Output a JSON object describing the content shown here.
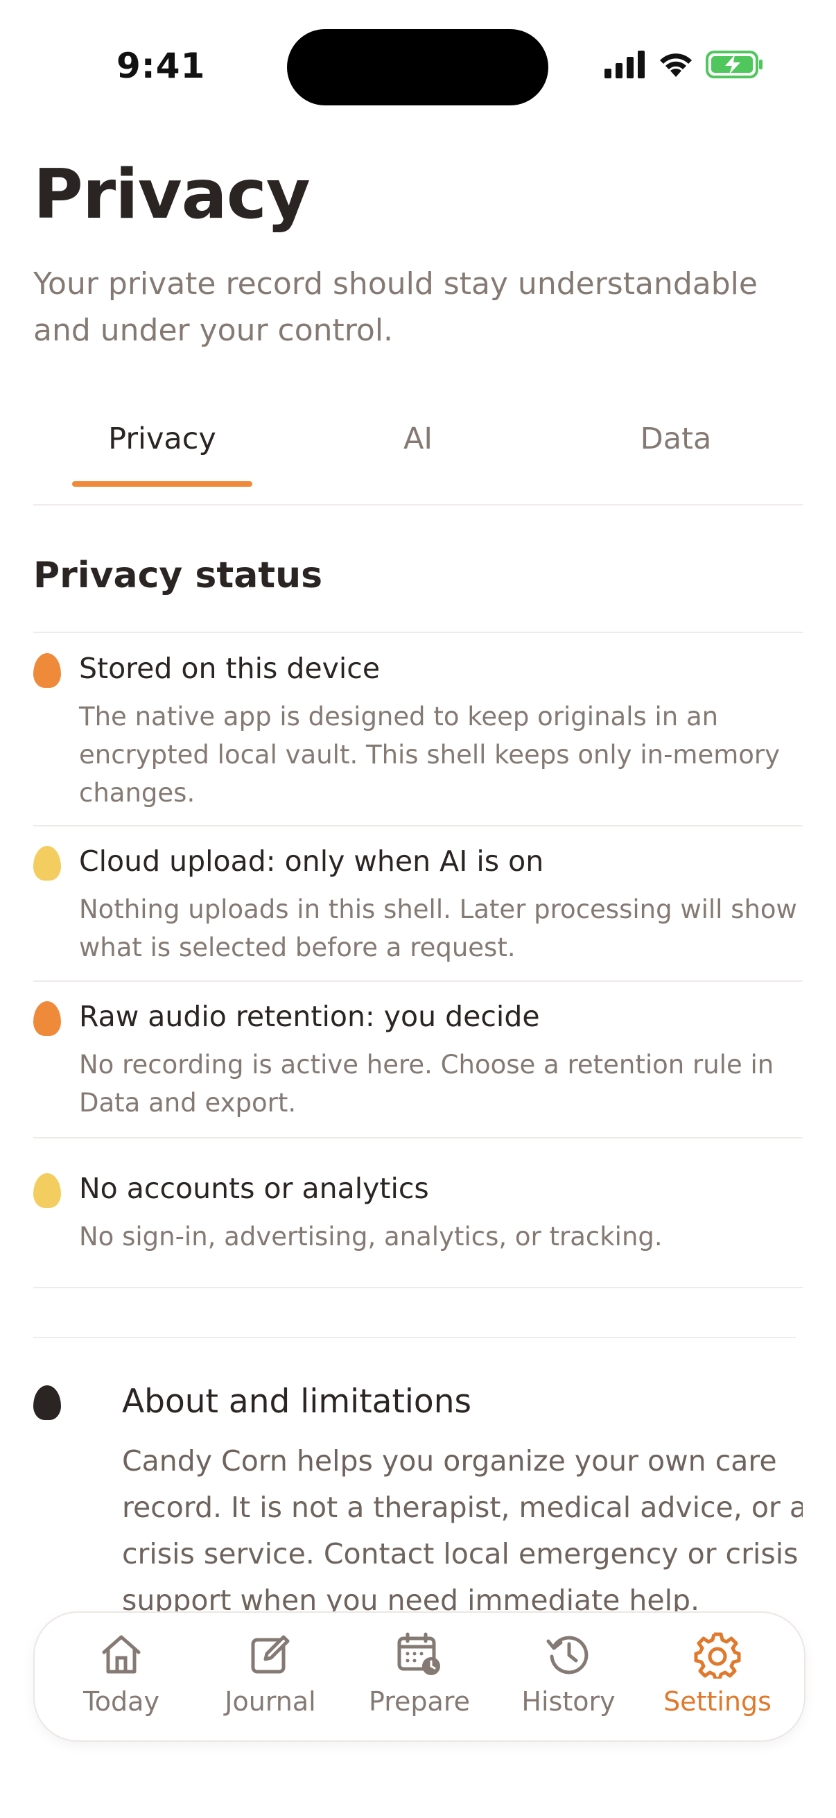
{
  "status_bar": {
    "time": "9:41"
  },
  "header": {
    "title": "Privacy",
    "subtitle": "Your private record should stay understandable and under your control."
  },
  "tabs": [
    {
      "label": "Privacy",
      "active": true
    },
    {
      "label": "AI",
      "active": false
    },
    {
      "label": "Data",
      "active": false
    }
  ],
  "privacy_status": {
    "title": "Privacy status",
    "items": [
      {
        "dot": "orange",
        "title": "Stored on this device",
        "description": "The native app is designed to keep originals in an encrypted local vault. This shell keeps only in-memory changes."
      },
      {
        "dot": "yellow",
        "title": "Cloud upload: only when AI is on",
        "description": "Nothing uploads in this shell. Later processing will show what is selected before a request."
      },
      {
        "dot": "orange",
        "title": "Raw audio retention: you decide",
        "description": "No recording is active here. Choose a retention rule in Data and export."
      },
      {
        "dot": "yellow",
        "title": "No accounts or analytics",
        "description": "No sign-in, advertising, analytics, or tracking."
      }
    ]
  },
  "about": {
    "title": "About and limitations",
    "text": "Candy Corn helps you organize your own care record. It is not a therapist, medical advice, or a crisis service. Contact local emergency or crisis support when you need immediate help."
  },
  "nav": [
    {
      "label": "Today",
      "icon": "home-icon",
      "active": false
    },
    {
      "label": "Journal",
      "icon": "edit-icon",
      "active": false
    },
    {
      "label": "Prepare",
      "icon": "calendar-clock-icon",
      "active": false
    },
    {
      "label": "History",
      "icon": "history-icon",
      "active": false
    },
    {
      "label": "Settings",
      "icon": "gear-icon",
      "active": true
    }
  ],
  "colors": {
    "accent": "#ef8a3b",
    "yellow": "#f3cd60",
    "text": "#2a2422",
    "muted": "#857a73"
  }
}
